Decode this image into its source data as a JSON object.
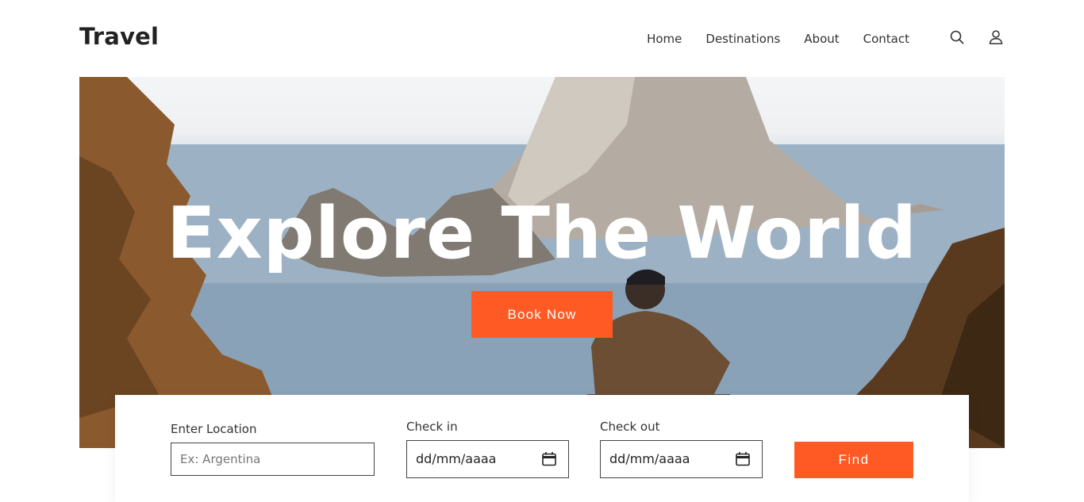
{
  "header": {
    "logo": "Travel",
    "nav": [
      "Home",
      "Destinations",
      "About",
      "Contact"
    ],
    "icons": [
      "search-icon",
      "user-icon"
    ]
  },
  "hero": {
    "title": "Explore The World",
    "cta_label": "Book Now"
  },
  "search_form": {
    "location_label": "Enter Location",
    "location_placeholder": "Ex: Argentina",
    "checkin_label": "Check in",
    "checkin_value": "dd/mm/aaaa",
    "checkout_label": "Check out",
    "checkout_value": "dd/mm/aaaa",
    "find_label": "Find"
  },
  "colors": {
    "accent": "#ff5a23",
    "text": "#2b2b2b"
  }
}
